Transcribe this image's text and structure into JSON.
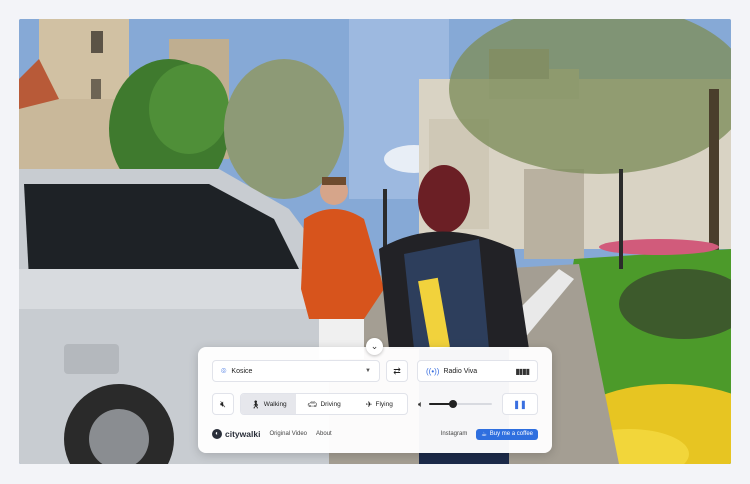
{
  "controls": {
    "city": {
      "value": "Kosice",
      "icon": "location-pin-icon"
    },
    "swap_icon": "swap-icon",
    "radio": {
      "label": "Radio Viva",
      "icon": "antenna-icon",
      "bars_icon": "audio-bars-icon"
    },
    "mute_icon": "speaker-mute-icon",
    "modes": [
      {
        "label": "Walking",
        "icon": "walking-icon",
        "active": true
      },
      {
        "label": "Driving",
        "icon": "car-icon",
        "active": false
      },
      {
        "label": "Flying",
        "icon": "plane-icon",
        "active": false
      }
    ],
    "volume": {
      "icon": "speaker-icon",
      "level": 0.38
    },
    "pause_icon": "pause-icon",
    "collapse_icon": "chevron-down-icon"
  },
  "footer": {
    "brand": "citywalki",
    "links": [
      "Original Video",
      "About"
    ],
    "instagram": "Instagram",
    "coffee": "Buy me a coffee"
  },
  "colors": {
    "accent": "#2f6fdf",
    "panel_bg": "#ffffff"
  }
}
